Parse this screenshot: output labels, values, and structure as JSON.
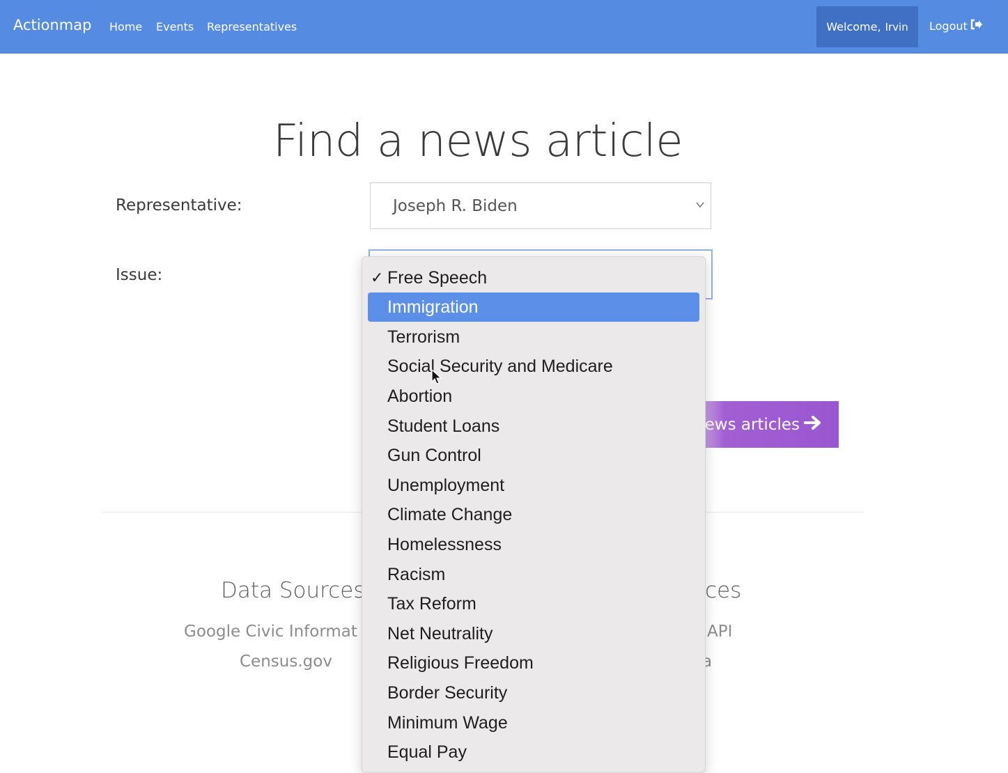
{
  "navbar": {
    "brand": "Actionmap",
    "links": [
      "Home",
      "Events",
      "Representatives"
    ],
    "welcome_label": "Welcome,",
    "username": "Irvin",
    "logout_label": "Logout",
    "color": "#558be0"
  },
  "main": {
    "title": "Find a news article",
    "representative_label": "Representative:",
    "representative_value": "Joseph R. Biden",
    "issue_label": "Issue:",
    "search_button_label": "ews articles",
    "button_color": "#9a56d0"
  },
  "footer": {
    "left_heading": "Data Sources",
    "left_items": [
      "Google Civic Informat",
      "Census.gov"
    ],
    "right_heading": "rces",
    "right_items": [
      "; API",
      "a"
    ]
  },
  "issue_dropdown": {
    "checked_option": "Free Speech",
    "highlighted_option": "Immigration",
    "options": [
      "Free Speech",
      "Immigration",
      "Terrorism",
      "Social Security and Medicare",
      "Abortion",
      "Student Loans",
      "Gun Control",
      "Unemployment",
      "Climate Change",
      "Homelessness",
      "Racism",
      "Tax Reform",
      "Net Neutrality",
      "Religious Freedom",
      "Border Security",
      "Minimum Wage",
      "Equal Pay"
    ],
    "highlight_color": "#5b8fe8"
  }
}
